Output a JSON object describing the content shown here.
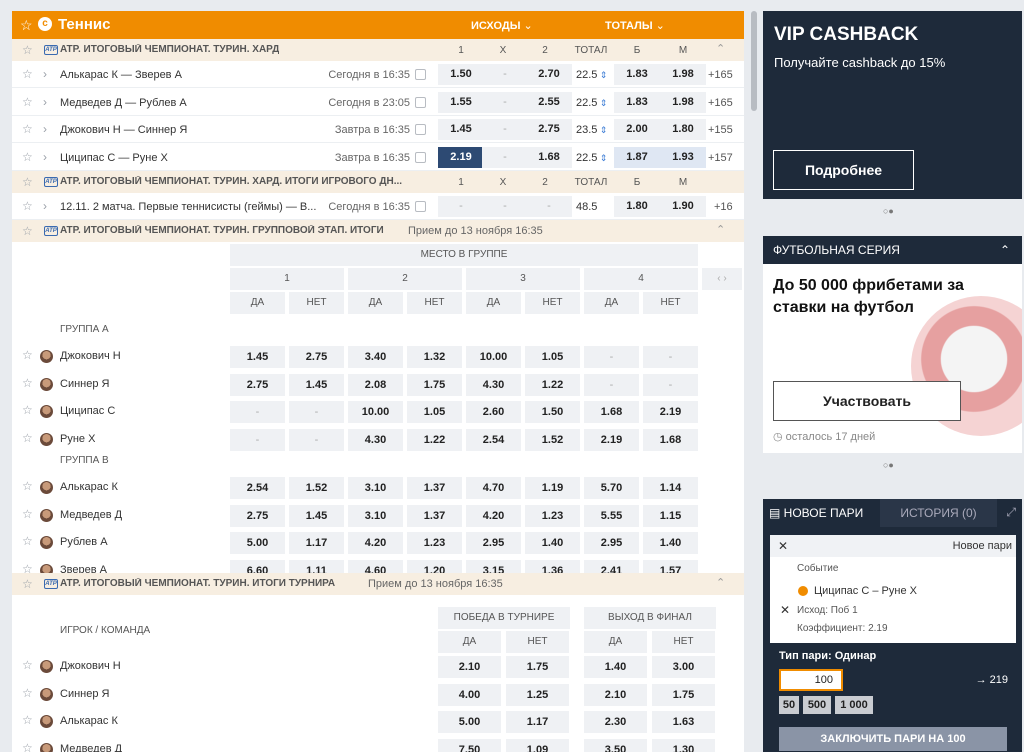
{
  "header": {
    "title": "Теннис",
    "outcomes": "ИСХОДЫ",
    "totals": "ТОТАЛЫ"
  },
  "cols": {
    "one": "1",
    "x": "X",
    "two": "2",
    "total": "ТОТАЛ",
    "b": "Б",
    "m": "М"
  },
  "league1": {
    "title": "ATP. ИТОГОВЫЙ ЧЕМПИОНАТ. ТУРИН. ХАРД",
    "tag": "ATP"
  },
  "matches": [
    {
      "name": "Алькарас К — Зверев А",
      "time": "Сегодня в 16:35",
      "k1": "1.50",
      "kx": "-",
      "k2": "2.70",
      "total": "22.5",
      "b": "1.83",
      "m": "1.98",
      "more": "+165"
    },
    {
      "name": "Медведев Д — Рублев А",
      "time": "Сегодня в 23:05",
      "k1": "1.55",
      "kx": "-",
      "k2": "2.55",
      "total": "22.5",
      "b": "1.83",
      "m": "1.98",
      "more": "+165"
    },
    {
      "name": "Джокович Н — Синнер Я",
      "time": "Завтра в 16:35",
      "k1": "1.45",
      "kx": "-",
      "k2": "2.75",
      "total": "23.5",
      "b": "2.00",
      "m": "1.80",
      "more": "+155"
    },
    {
      "name": "Циципас С — Руне Х",
      "time": "Завтра в 16:35",
      "k1": "2.19",
      "kx": "-",
      "k2": "1.68",
      "total": "22.5",
      "b": "1.87",
      "m": "1.93",
      "more": "+157"
    }
  ],
  "league2": {
    "title": "ATP. ИТОГОВЫЙ ЧЕМПИОНАТ. ТУРИН. ХАРД. ИТОГИ ИГРОВОГО ДН..."
  },
  "match5": {
    "name": "12.11. 2 матча. Первые теннисисты (геймы) — В...",
    "time": "Сегодня в 16:35",
    "k1": "-",
    "kx": "-",
    "k2": "-",
    "total": "48.5",
    "b": "1.80",
    "m": "1.90",
    "more": "+16"
  },
  "league3": {
    "title": "ATP. ИТОГОВЫЙ ЧЕМПИОНАТ. ТУРИН. ГРУППОВОЙ ЭТАП. ИТОГИ",
    "note": "Прием до 13 ноября 16:35"
  },
  "group_table": {
    "place_header": "МЕСТО В ГРУППЕ",
    "places": [
      "1",
      "2",
      "3",
      "4"
    ],
    "yes": "ДА",
    "no": "НЕТ",
    "groupA": "ГРУППА А",
    "groupB": "ГРУППА B",
    "rowsA": [
      {
        "name": "Джокович Н",
        "v": [
          "1.45",
          "2.75",
          "3.40",
          "1.32",
          "10.00",
          "1.05",
          "-",
          "-"
        ]
      },
      {
        "name": "Синнер Я",
        "v": [
          "2.75",
          "1.45",
          "2.08",
          "1.75",
          "4.30",
          "1.22",
          "-",
          "-"
        ]
      },
      {
        "name": "Циципас С",
        "v": [
          "-",
          "-",
          "10.00",
          "1.05",
          "2.60",
          "1.50",
          "1.68",
          "2.19"
        ]
      },
      {
        "name": "Руне Х",
        "v": [
          "-",
          "-",
          "4.30",
          "1.22",
          "2.54",
          "1.52",
          "2.19",
          "1.68"
        ]
      }
    ],
    "rowsB": [
      {
        "name": "Алькарас К",
        "v": [
          "2.54",
          "1.52",
          "3.10",
          "1.37",
          "4.70",
          "1.19",
          "5.70",
          "1.14"
        ]
      },
      {
        "name": "Медведев Д",
        "v": [
          "2.75",
          "1.45",
          "3.10",
          "1.37",
          "4.20",
          "1.23",
          "5.55",
          "1.15"
        ]
      },
      {
        "name": "Рублев А",
        "v": [
          "5.00",
          "1.17",
          "4.20",
          "1.23",
          "2.95",
          "1.40",
          "2.95",
          "1.40"
        ]
      },
      {
        "name": "Зверев А",
        "v": [
          "6.60",
          "1.11",
          "4.60",
          "1.20",
          "3.15",
          "1.36",
          "2.41",
          "1.57"
        ]
      }
    ]
  },
  "league4": {
    "title": "ATP. ИТОГОВЫЙ ЧЕМПИОНАТ. ТУРИН. ИТОГИ ТУРНИРА",
    "note": "Прием до 13 ноября 16:35"
  },
  "tour_table": {
    "player_team": "ИГРОК / КОМАНДА",
    "win": "ПОБЕДА В ТУРНИРЕ",
    "final": "ВЫХОД В ФИНАЛ",
    "yes": "ДА",
    "no": "НЕТ",
    "rows": [
      {
        "name": "Джокович Н",
        "v": [
          "2.10",
          "1.75",
          "1.40",
          "3.00"
        ]
      },
      {
        "name": "Синнер Я",
        "v": [
          "4.00",
          "1.25",
          "2.10",
          "1.75"
        ]
      },
      {
        "name": "Алькарас К",
        "v": [
          "5.00",
          "1.17",
          "2.30",
          "1.63"
        ]
      },
      {
        "name": "Медведев Д",
        "v": [
          "7.50",
          "1.09",
          "3.50",
          "1.30"
        ]
      }
    ]
  },
  "vip": {
    "title": "VIP CASHBACK",
    "subtitle": "Получайте cashback до 15%",
    "button": "Подробнее"
  },
  "football": {
    "header": "ФУТБОЛЬНАЯ СЕРИЯ",
    "title": "До 50 000 фрибетами за ставки на футбол",
    "button": "Участвовать",
    "left": "осталось 17 дней"
  },
  "betslip": {
    "tab_new": "НОВОЕ ПАРИ",
    "tab_history": "ИСТОРИЯ (0)",
    "new_bet": "Новое пари",
    "event_label": "Событие",
    "event": "Циципас С – Руне Х",
    "outcome": "Исход: Поб 1",
    "coef": "Коэффициент: 2.19",
    "type": "Тип пари: Одинар",
    "amount": "100",
    "win": "→ 219",
    "quick": [
      "50",
      "500",
      "1 000"
    ],
    "submit": "ЗАКЛЮЧИТЬ ПАРИ НА 100"
  }
}
